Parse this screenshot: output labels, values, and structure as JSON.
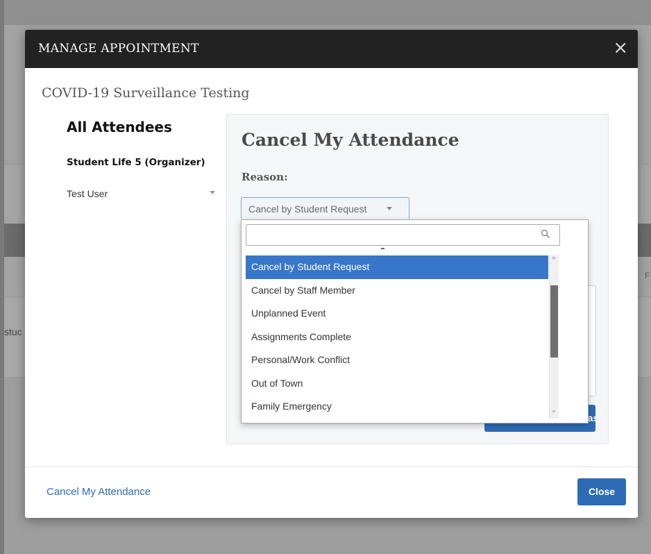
{
  "background": {
    "side_text": "stuc",
    "side_letter": "F"
  },
  "modal": {
    "title": "MANAGE APPOINTMENT",
    "close_symbol": "×",
    "appointment_title": "COVID-19 Surveillance Testing"
  },
  "attendees": {
    "heading": "All Attendees",
    "organizer": "Student Life 5 (Organizer)",
    "items": [
      {
        "label": "Test User",
        "icon": "chevron-down-icon"
      }
    ]
  },
  "cancel_panel": {
    "heading": "Cancel My Attendance",
    "reason_label": "Reason:",
    "reason_select": {
      "value": "Cancel by Student Request",
      "search_value": "",
      "search_icon": "search-icon",
      "options": [
        "Cancel by Student Request",
        "Cancel by Staff Member",
        "Unplanned Event",
        "Assignments Complete",
        "Personal/Work Conflict",
        "Out of Town",
        "Family Emergency"
      ],
      "highlighted_index": 0
    },
    "submit_label": "Mark as Cancelled"
  },
  "footer": {
    "cancel_link": "Cancel My Attendance",
    "close_label": "Close"
  },
  "colors": {
    "header_bg": "#222222",
    "primary": "#2d6cb5",
    "highlight": "#3876c9",
    "panel_bg": "#f4f6f8"
  }
}
